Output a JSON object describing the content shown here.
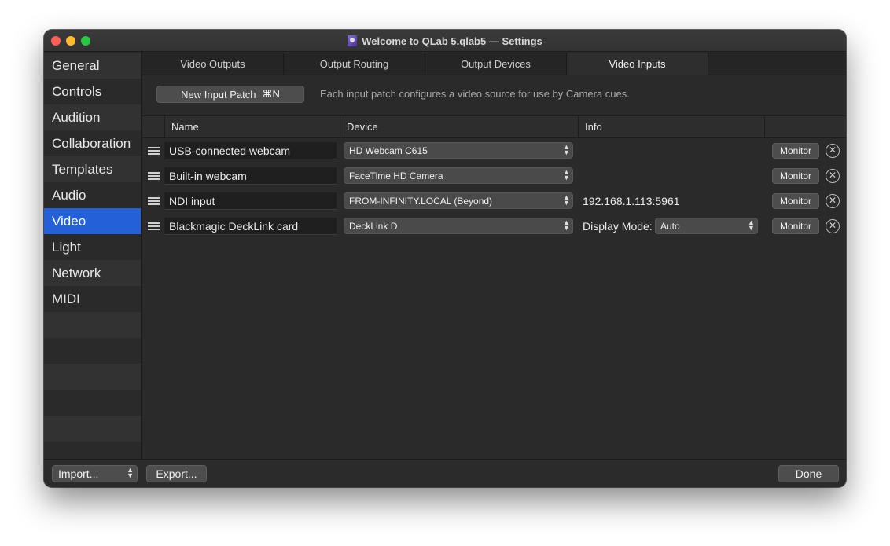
{
  "window": {
    "title": "Welcome to QLab 5.qlab5 — Settings"
  },
  "sidebar": {
    "items": [
      {
        "label": "General",
        "selected": false
      },
      {
        "label": "Controls",
        "selected": false
      },
      {
        "label": "Audition",
        "selected": false
      },
      {
        "label": "Collaboration",
        "selected": false
      },
      {
        "label": "Templates",
        "selected": false
      },
      {
        "label": "Audio",
        "selected": false
      },
      {
        "label": "Video",
        "selected": true
      },
      {
        "label": "Light",
        "selected": false
      },
      {
        "label": "Network",
        "selected": false
      },
      {
        "label": "MIDI",
        "selected": false
      }
    ],
    "accent_color": "#2461d9"
  },
  "tabs": [
    {
      "label": "Video Outputs",
      "active": false
    },
    {
      "label": "Output Routing",
      "active": false
    },
    {
      "label": "Output Devices",
      "active": false
    },
    {
      "label": "Video Inputs",
      "active": true
    }
  ],
  "toolbar": {
    "new_patch_label": "New Input Patch",
    "new_patch_shortcut": "⌘N",
    "hint": "Each input patch configures a video source for use by Camera cues."
  },
  "table": {
    "columns": [
      "Name",
      "Device",
      "Info"
    ],
    "rows": [
      {
        "name": "USB-connected webcam",
        "device": "HD Webcam C615",
        "info": "",
        "monitor_label": "Monitor"
      },
      {
        "name": "Built-in webcam",
        "device": "FaceTime HD Camera",
        "info": "",
        "monitor_label": "Monitor"
      },
      {
        "name": "NDI input",
        "device": "FROM-INFINITY.LOCAL (Beyond)",
        "info": "192.168.1.113:5961",
        "monitor_label": "Monitor"
      },
      {
        "name": "Blackmagic DeckLink card",
        "device": "DeckLink D",
        "info_label": "Display Mode:",
        "display_mode": "Auto",
        "monitor_label": "Monitor"
      }
    ]
  },
  "footer": {
    "import_label": "Import...",
    "export_label": "Export...",
    "done_label": "Done"
  },
  "icons": {
    "remove": "circle-x-icon",
    "drag": "drag-handle-icon",
    "popup": "chevron-up-down-icon"
  }
}
